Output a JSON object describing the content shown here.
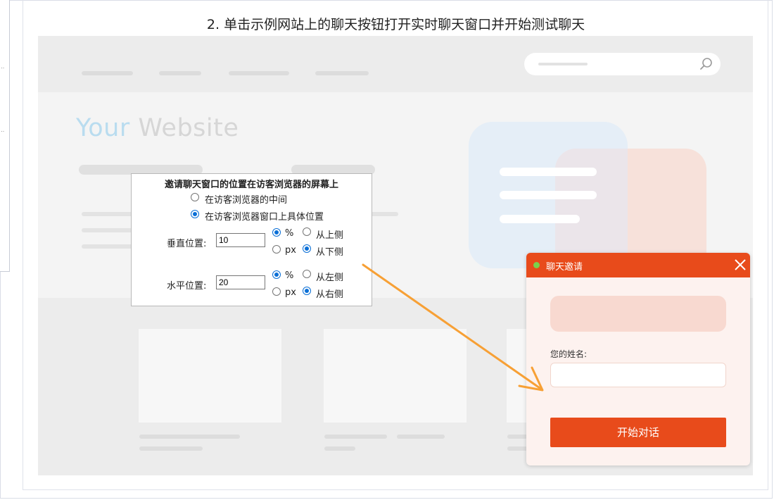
{
  "step_title": "2. 单击示例网站上的聊天按钮打开实时聊天窗口并开始测试聊天",
  "mock_site": {
    "hero_word1": "Your",
    "hero_word2": "Website",
    "search_icon": "search-icon"
  },
  "settings": {
    "heading": "邀请聊天窗口的位置在访客浏览器的屏幕上",
    "option_center": "在访客浏览器的中间",
    "option_specific": "在访客浏览器窗口上具体位置",
    "selected_option": "specific",
    "vertical": {
      "label": "垂直位置:",
      "value": "10",
      "unit_percent": "%",
      "unit_px": "px",
      "unit_selected": "%",
      "from_top": "从上侧",
      "from_bottom": "从下侧",
      "anchor_selected": "bottom"
    },
    "horizontal": {
      "label": "水平位置:",
      "value": "20",
      "unit_percent": "%",
      "unit_px": "px",
      "unit_selected": "%",
      "from_left": "从左侧",
      "from_right": "从右侧",
      "anchor_selected": "right"
    }
  },
  "chat_widget": {
    "title": "聊天邀请",
    "status_color": "#7ad14b",
    "header_color": "#e84b1b",
    "name_label": "您的姓名:",
    "name_value": "",
    "start_button": "开始对话",
    "close_icon": "close-icon"
  },
  "arrow_color": "#f7a035"
}
